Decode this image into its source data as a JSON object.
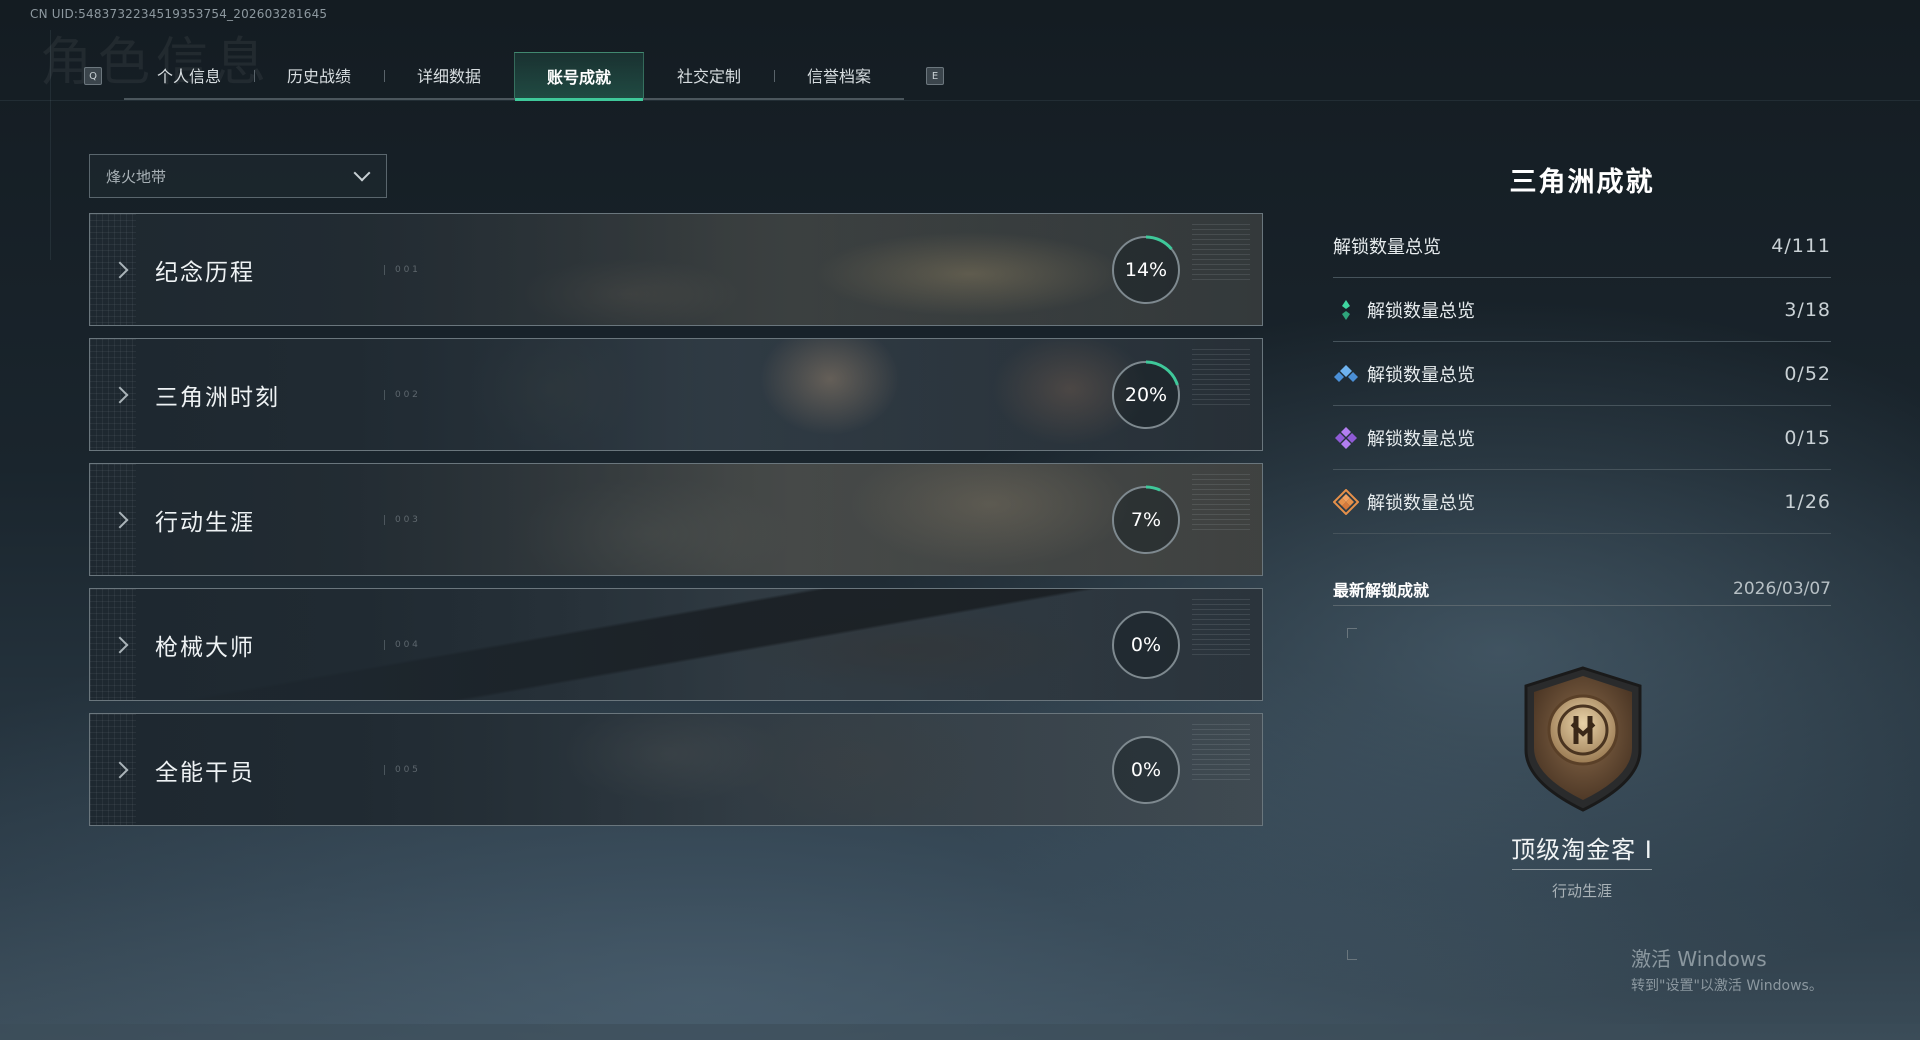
{
  "uid_text": "CN UID:548373223451935375 54_202603281645",
  "uid_display": "CN UID:5483732234519353754_202603281645",
  "ghost_title": "角色信息",
  "tabs": {
    "left_key": "Q",
    "right_key": "E",
    "items": [
      "个人信息",
      "历史战绩",
      "详细数据",
      "账号成就",
      "社交定制",
      "信誉档案"
    ],
    "active_index": 3
  },
  "mode_select": {
    "value": "烽火地带"
  },
  "categories": [
    {
      "name": "纪念历程",
      "index": "0 0 1",
      "percent": 14,
      "percent_label": "14%"
    },
    {
      "name": "三角洲时刻",
      "index": "0 0 2",
      "percent": 20,
      "percent_label": "20%"
    },
    {
      "name": "行动生涯",
      "index": "0 0 3",
      "percent": 7,
      "percent_label": "7%"
    },
    {
      "name": "枪械大师",
      "index": "0 0 4",
      "percent": 0,
      "percent_label": "0%"
    },
    {
      "name": "全能干员",
      "index": "0 0 5",
      "percent": 0,
      "percent_label": "0%"
    }
  ],
  "panel": {
    "title": "三角洲成就",
    "total": {
      "label": "解锁数量总览",
      "value": "4/111"
    },
    "tiers": [
      {
        "label": "解锁数量总览",
        "value": "3/18",
        "icon": "green-gem-icon",
        "color": "#3fd6a0"
      },
      {
        "label": "解锁数量总览",
        "value": "0/52",
        "icon": "blue-gem-icon",
        "color": "#5aa3e6"
      },
      {
        "label": "解锁数量总览",
        "value": "0/15",
        "icon": "purple-gem-icon",
        "color": "#a36ae6"
      },
      {
        "label": "解锁数量总览",
        "value": "1/26",
        "icon": "orange-gem-icon",
        "color": "#e6904a"
      }
    ],
    "latest": {
      "label": "最新解锁成就",
      "date": "2026/03/07",
      "achievement_name": "顶级淘金客 I",
      "achievement_category": "行动生涯"
    }
  },
  "watermark": {
    "line1": "激活 Windows",
    "line2": "转到\"设置\"以激活 Windows。"
  },
  "colors": {
    "accent": "#3fc89a",
    "ring_track": "#7e898f"
  }
}
